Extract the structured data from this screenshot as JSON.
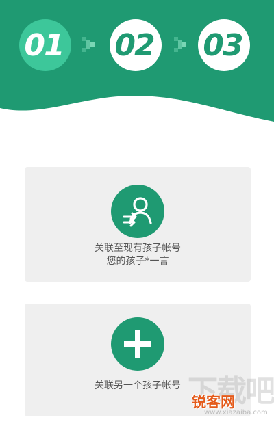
{
  "steps": [
    {
      "label": "01",
      "state": "active"
    },
    {
      "label": "02",
      "state": "pending"
    },
    {
      "label": "03",
      "state": "pending"
    }
  ],
  "options": [
    {
      "line1": "关联至现有孩子帐号",
      "line2": "您的孩子*一言",
      "icon": "person-link-icon"
    },
    {
      "line1": "关联另一个孩子帐号",
      "icon": "plus-icon"
    }
  ],
  "watermark": {
    "big": "下载吧",
    "logo": "锐客网",
    "url": "www.xiazaiba.com"
  },
  "colors": {
    "primary": "#1f9a72",
    "active_step": "#3dc79a",
    "card_bg": "#efefef",
    "text": "#555555"
  }
}
